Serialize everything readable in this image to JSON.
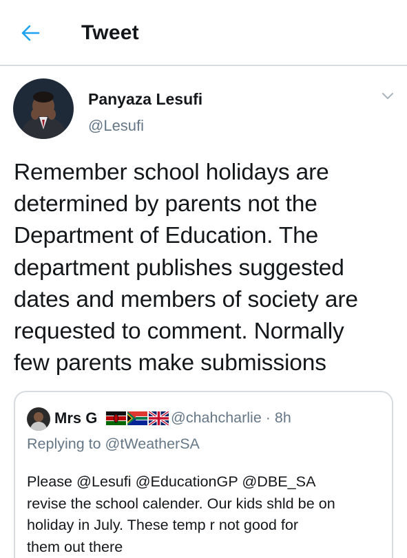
{
  "header": {
    "title": "Tweet"
  },
  "tweet": {
    "author_name": "Panyaza Lesufi",
    "author_handle": "@Lesufi",
    "text_lines": [
      "Remember school holidays are",
      "determined by parents not the",
      "Department of Education. The",
      "department publishes suggested",
      "dates and members of society are",
      "requested to comment. Normally",
      "few parents make submissions"
    ]
  },
  "quoted": {
    "name": "Mrs G",
    "handle_time": "@chahcharlie · 8h",
    "replying_to": "Replying to @tWeatherSA",
    "text_lines": [
      "Please @Lesufi @EducationGP @DBE_SA",
      "revise the school calender. Our kids shld be on",
      "holiday in July. These temp r not good for",
      "them out there"
    ]
  },
  "icons": {
    "back": "arrow-left-icon",
    "caret": "chevron-down-icon",
    "flags": [
      "kenya-flag-icon",
      "south-africa-flag-icon",
      "uk-flag-icon"
    ]
  },
  "colors": {
    "accent": "#1da1f2",
    "text": "#14171a",
    "secondary": "#657786",
    "border": "#d7dbdf"
  }
}
